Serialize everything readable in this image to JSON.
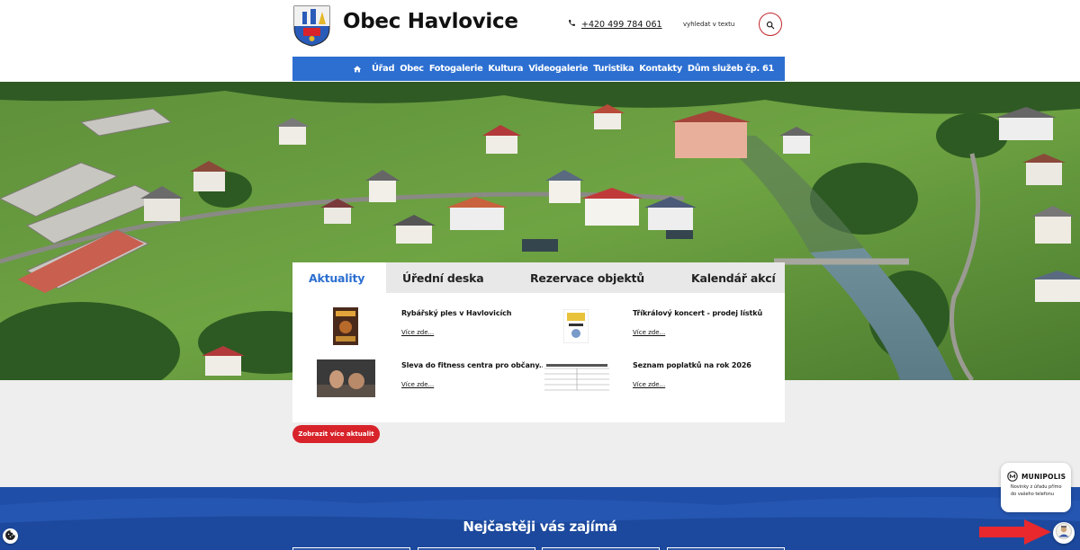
{
  "header": {
    "title": "Obec Havlovice",
    "phone": "+420 499 784 061",
    "search_label": "vyhledat v textu"
  },
  "nav": {
    "items": [
      "Úřad",
      "Obec",
      "Fotogalerie",
      "Kultura",
      "Videogalerie",
      "Turistika",
      "Kontakty",
      "Dům služeb čp. 61"
    ]
  },
  "tabs": [
    "Aktuality",
    "Úřední deska",
    "Rezervace objektů",
    "Kalendář akcí"
  ],
  "news": [
    {
      "title": "Rybářský ples v Havlovicích",
      "more": "Více zde..."
    },
    {
      "title": "Tříkrálový koncert - prodej lístků",
      "more": "Více zde..."
    },
    {
      "title": "Sleva do fitness centra pro občany...",
      "more": "Více zde..."
    },
    {
      "title": "Seznam poplatků na rok 2026",
      "more": "Více zde..."
    }
  ],
  "more_button": "Zobrazit více aktualit",
  "bottom_title": "Nejčastěji vás zajímá",
  "widget": {
    "name": "MUNIPOLIS",
    "text": "Novinky z úřadu přímo do vašeho telefonu"
  },
  "colors": {
    "primary_blue": "#2c6fd1",
    "accent_red": "#d8232a",
    "footer_blue": "#1f4ea8"
  },
  "icons": {
    "home": "home-icon",
    "phone": "phone-icon",
    "search": "search-icon",
    "cookie": "cookie-icon"
  }
}
